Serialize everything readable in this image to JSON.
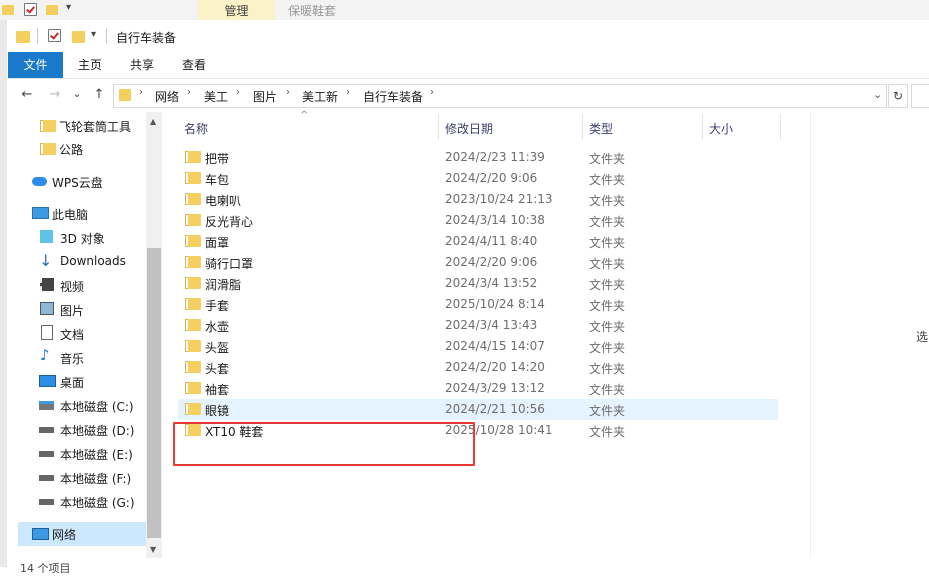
{
  "back_window": {
    "tab_manage": "管理",
    "tab_other": "保暖鞋套"
  },
  "window": {
    "title": "自行车装备"
  },
  "ribbon": {
    "tabs": [
      {
        "label": "文件",
        "active": true
      },
      {
        "label": "主页"
      },
      {
        "label": "共享"
      },
      {
        "label": "查看"
      }
    ],
    "accent": "#1979ca"
  },
  "nav": {
    "back_icon": "←",
    "forward_icon": "→",
    "recent_icon": "⌄",
    "up_icon": "↑"
  },
  "address": {
    "crumbs": [
      "网络",
      "美工",
      "图片",
      "美工新",
      "自行车装备"
    ]
  },
  "sidebar": {
    "items": [
      {
        "label": "飞轮套筒工具",
        "icon": "folder-icon"
      },
      {
        "label": "公路",
        "icon": "folder-icon"
      },
      {
        "label": "WPS云盘",
        "icon": "cloud-icon"
      },
      {
        "label": "此电脑",
        "icon": "computer-icon"
      },
      {
        "label": "3D 对象",
        "icon": "3d-objects-icon"
      },
      {
        "label": "Downloads",
        "icon": "download-icon"
      },
      {
        "label": "视频",
        "icon": "video-icon"
      },
      {
        "label": "图片",
        "icon": "picture-icon"
      },
      {
        "label": "文档",
        "icon": "document-icon"
      },
      {
        "label": "音乐",
        "icon": "music-icon"
      },
      {
        "label": "桌面",
        "icon": "desktop-icon"
      },
      {
        "label": "本地磁盘 (C:)",
        "icon": "drive-icon"
      },
      {
        "label": "本地磁盘 (D:)",
        "icon": "drive-icon"
      },
      {
        "label": "本地磁盘 (E:)",
        "icon": "drive-icon"
      },
      {
        "label": "本地磁盘 (F:)",
        "icon": "drive-icon"
      },
      {
        "label": "本地磁盘 (G:)",
        "icon": "drive-icon"
      },
      {
        "label": "网络",
        "icon": "network-icon"
      }
    ]
  },
  "columns": {
    "name": "名称",
    "date": "修改日期",
    "type": "类型",
    "size": "大小"
  },
  "files": [
    {
      "name": "把带",
      "date": "2024/2/23 11:39",
      "type": "文件夹"
    },
    {
      "name": "车包",
      "date": "2024/2/20 9:06",
      "type": "文件夹"
    },
    {
      "name": "电喇叭",
      "date": "2023/10/24 21:13",
      "type": "文件夹"
    },
    {
      "name": "反光背心",
      "date": "2024/3/14 10:38",
      "type": "文件夹"
    },
    {
      "name": "面罩",
      "date": "2024/4/11 8:40",
      "type": "文件夹"
    },
    {
      "name": "骑行口罩",
      "date": "2024/2/20 9:06",
      "type": "文件夹"
    },
    {
      "name": "润滑脂",
      "date": "2024/3/4 13:52",
      "type": "文件夹"
    },
    {
      "name": "手套",
      "date": "2025/10/24 8:14",
      "type": "文件夹"
    },
    {
      "name": "水壶",
      "date": "2024/3/4 13:43",
      "type": "文件夹"
    },
    {
      "name": "头盔",
      "date": "2024/4/15 14:07",
      "type": "文件夹"
    },
    {
      "name": "头套",
      "date": "2024/2/20 14:20",
      "type": "文件夹"
    },
    {
      "name": "袖套",
      "date": "2024/3/29 13:12",
      "type": "文件夹"
    },
    {
      "name": "眼镜",
      "date": "2024/2/21 10:56",
      "type": "文件夹"
    },
    {
      "name": "XT10 鞋套",
      "date": "2025/10/28 10:41",
      "type": "文件夹"
    }
  ],
  "right_pane_text": "选",
  "status": "14 个项目",
  "colors": {
    "selection": "#e5f3ff",
    "highlight_box": "#e53935",
    "folder": "#f5d061"
  }
}
